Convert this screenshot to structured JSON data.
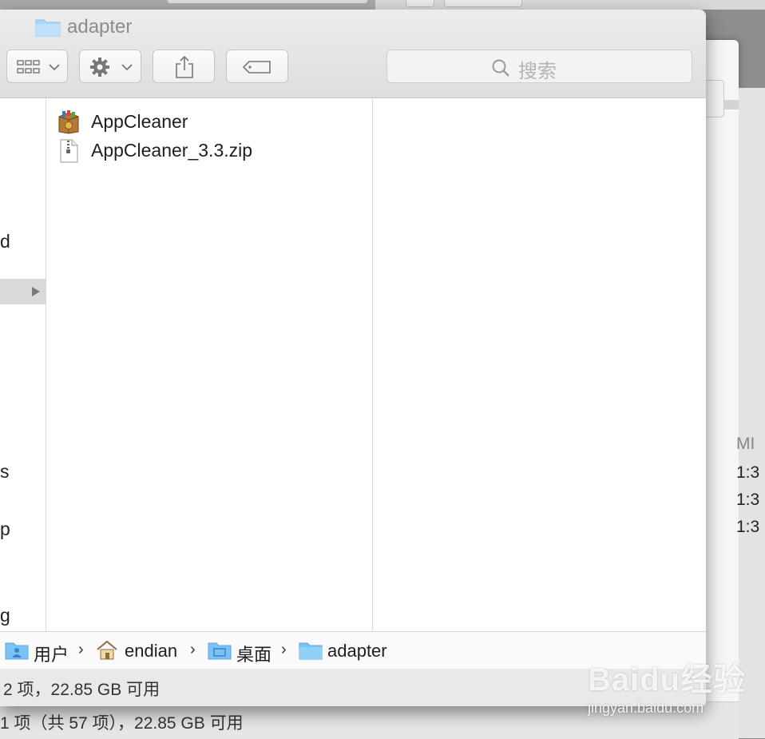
{
  "window": {
    "title": "adapter"
  },
  "toolbar": {
    "view_button": "view-options",
    "action_button": "action-menu",
    "share_button": "share",
    "tag_button": "tags",
    "search_placeholder": "搜索"
  },
  "sidebar_fragments": [
    {
      "text": "d",
      "top": 0
    },
    {
      "text": "s",
      "top": 0
    },
    {
      "text": "p",
      "top": 0
    },
    {
      "text": "g",
      "top": 0
    }
  ],
  "files": [
    {
      "name": "AppCleaner",
      "icon": "app-icon"
    },
    {
      "name": "AppCleaner_3.3.zip",
      "icon": "zip-file-icon"
    }
  ],
  "path": [
    "用户",
    "endian",
    "桌面",
    "adapter"
  ],
  "status": "2 项，22.85 GB 可用",
  "background_window": {
    "status": "1 项（共 57 项），22.85 GB 可用",
    "right_fragments": [
      "MI",
      "1:3",
      "1:3",
      "1:3"
    ]
  },
  "watermark": {
    "brand": "Baidu经验",
    "url": "jingyan.baidu.com"
  },
  "colors": {
    "folder": "#7cc3f5",
    "selection": "#d9d9d9"
  }
}
